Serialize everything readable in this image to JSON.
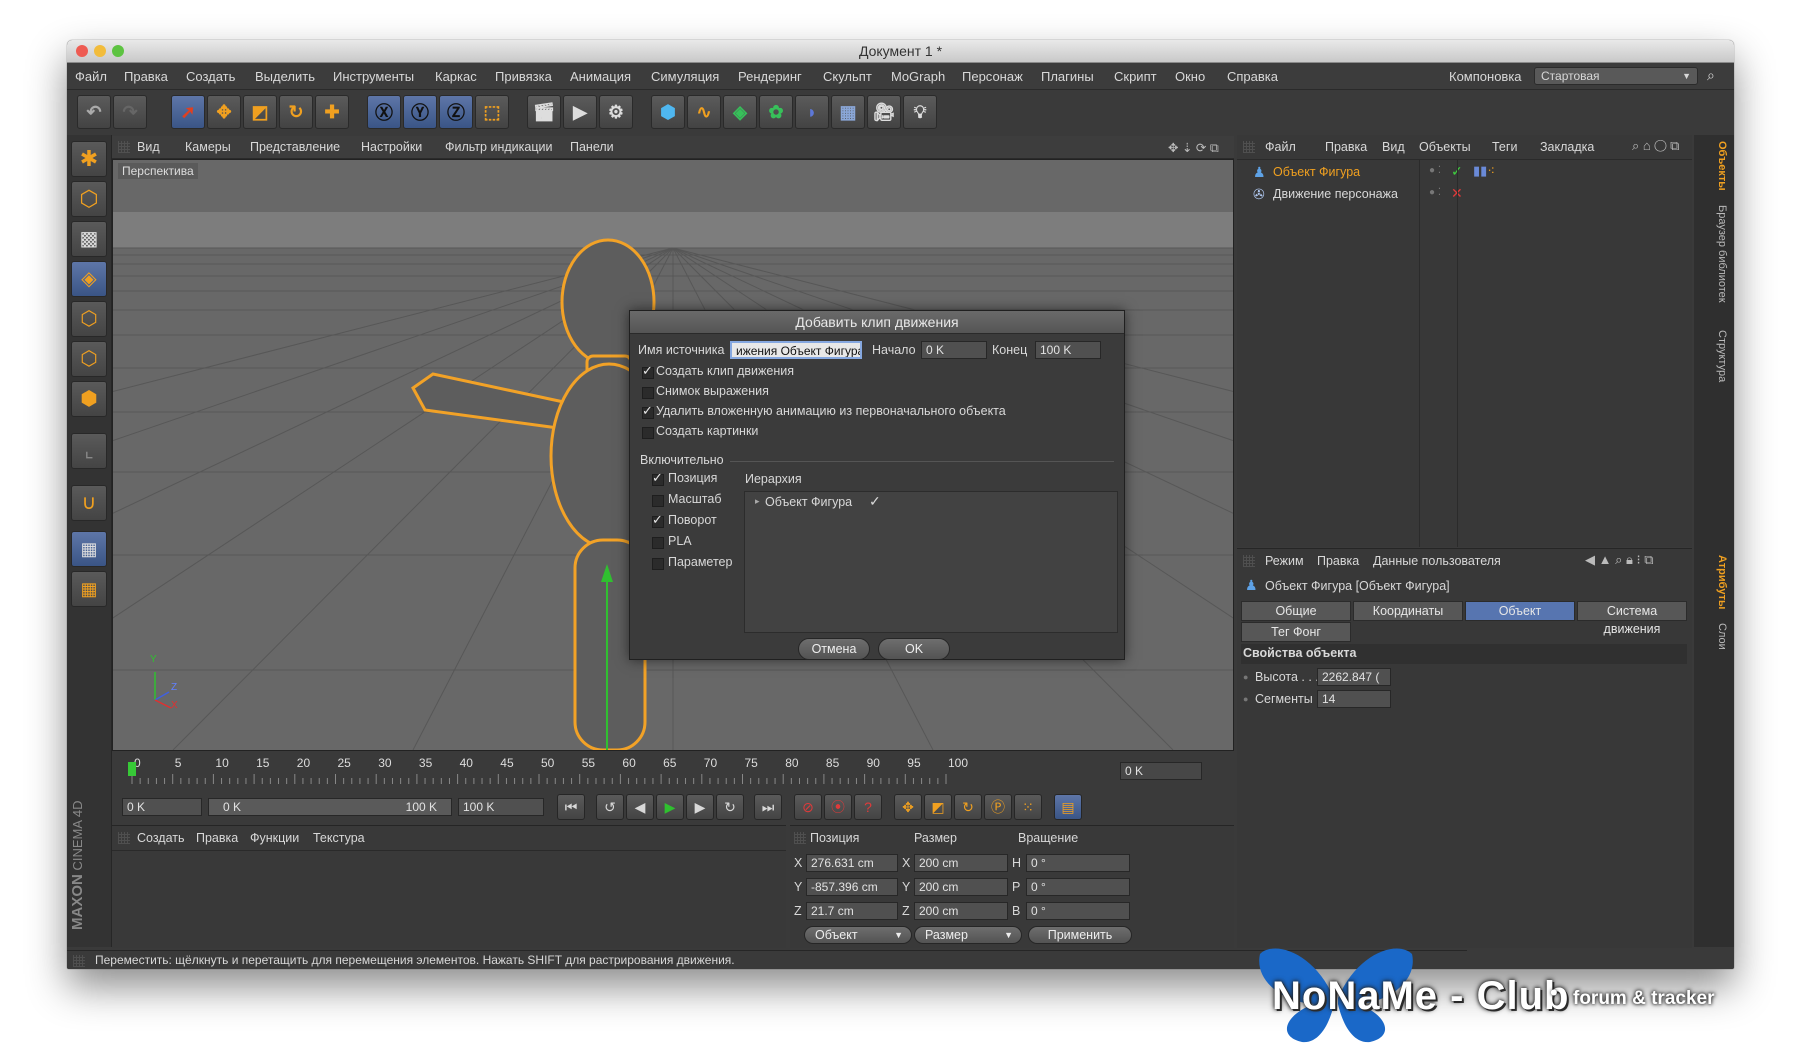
{
  "window": {
    "title": "Документ 1 *"
  },
  "menu": [
    "Файл",
    "Правка",
    "Создать",
    "Выделить",
    "Инструменты",
    "Каркас",
    "Привязка",
    "Анимация",
    "Симуляция",
    "Рендеринг",
    "Скульпт",
    "MoGraph",
    "Персонаж",
    "Плагины",
    "Скрипт",
    "Окно",
    "Справка"
  ],
  "layout": {
    "label": "Компоновка",
    "value": "Стартовая"
  },
  "viewport": {
    "menu": [
      "Вид",
      "Камеры",
      "Представление",
      "Настройки",
      "Фильтр индикации",
      "Панели"
    ],
    "label": "Перспектива",
    "axes": {
      "y": "Y",
      "z": "Z",
      "x": "X"
    }
  },
  "dialog": {
    "title": "Добавить клип движения",
    "source_label": "Имя источника",
    "source_value": "ижения Объект Фигура",
    "start_label": "Начало",
    "start_value": "0 K",
    "end_label": "Конец",
    "end_value": "100 K",
    "options": [
      {
        "label": "Создать клип движения",
        "checked": true
      },
      {
        "label": "Снимок выражения",
        "checked": false
      },
      {
        "label": "Удалить вложенную анимацию из первоначального объекта",
        "checked": true
      },
      {
        "label": "Создать картинки",
        "checked": false
      }
    ],
    "include_label": "Включительно",
    "include": [
      {
        "label": "Позиция",
        "checked": true
      },
      {
        "label": "Масштаб",
        "checked": false
      },
      {
        "label": "Поворот",
        "checked": true
      },
      {
        "label": "PLA",
        "checked": false
      },
      {
        "label": "Параметер",
        "checked": false
      }
    ],
    "hierarchy_label": "Иерархия",
    "hierarchy_item": "Объект Фигура",
    "hierarchy_check": "✓",
    "cancel": "Отмена",
    "ok": "OK"
  },
  "objects": {
    "menu": [
      "Файл",
      "Правка",
      "Вид",
      "Объекты",
      "Теги",
      "Закладка"
    ],
    "items": [
      {
        "name": "Объект Фигура",
        "selected": true
      },
      {
        "name": "Движение персонажа",
        "selected": false
      }
    ]
  },
  "attributes": {
    "menu": [
      "Режим",
      "Правка",
      "Данные пользователя"
    ],
    "header": "Объект Фигура [Объект Фигура]",
    "tabs": [
      "Общие",
      "Координаты",
      "Объект",
      "Система движения",
      "Тег Фонг"
    ],
    "active_tab": "Объект",
    "section": "Свойства объекта",
    "fields": [
      {
        "label": "Высота . . .",
        "value": "2262.847 ("
      },
      {
        "label": "Сегменты",
        "value": "14"
      }
    ]
  },
  "side_tabs": [
    "Объекты",
    "Браузер библиотек",
    "Структура",
    "Атрибуты",
    "Слои"
  ],
  "timeline": {
    "ticks": [
      "0",
      "5",
      "10",
      "15",
      "20",
      "25",
      "30",
      "35",
      "40",
      "45",
      "50",
      "55",
      "60",
      "65",
      "70",
      "75",
      "80",
      "85",
      "90",
      "95",
      "100"
    ],
    "current_value": "0 K"
  },
  "transport": {
    "start": "0 K",
    "range_start": "0 K",
    "range_end": "100 K",
    "end": "100 K"
  },
  "materials": {
    "menu": [
      "Создать",
      "Правка",
      "Функции",
      "Текстура"
    ]
  },
  "coords": {
    "headers": [
      "Позиция",
      "Размер",
      "Вращение"
    ],
    "rows": [
      {
        "pos_axis": "X",
        "pos": "276.631 cm",
        "size_axis": "X",
        "size": "200 cm",
        "rot_axis": "H",
        "rot": "0 °"
      },
      {
        "pos_axis": "Y",
        "pos": "-857.396 cm",
        "size_axis": "Y",
        "size": "200 cm",
        "rot_axis": "P",
        "rot": "0 °"
      },
      {
        "pos_axis": "Z",
        "pos": "21.7 cm",
        "size_axis": "Z",
        "size": "200 cm",
        "rot_axis": "B",
        "rot": "0 °"
      }
    ],
    "mode1": "Объект",
    "mode2": "Размер",
    "apply": "Применить"
  },
  "status": "Переместить: щёлкнуть и перетащить для перемещения элементов. Нажать SHIFT для растрирования движения.",
  "branding": {
    "maxon": "MAXON",
    "cinema": "CINEMA 4D"
  },
  "watermark": {
    "logo": "NoNaMe - Club",
    "tagline": "forum & tracker"
  },
  "colors": {
    "accent": "#f0a020",
    "selection": "#5775b0",
    "play": "#2fc02f"
  }
}
